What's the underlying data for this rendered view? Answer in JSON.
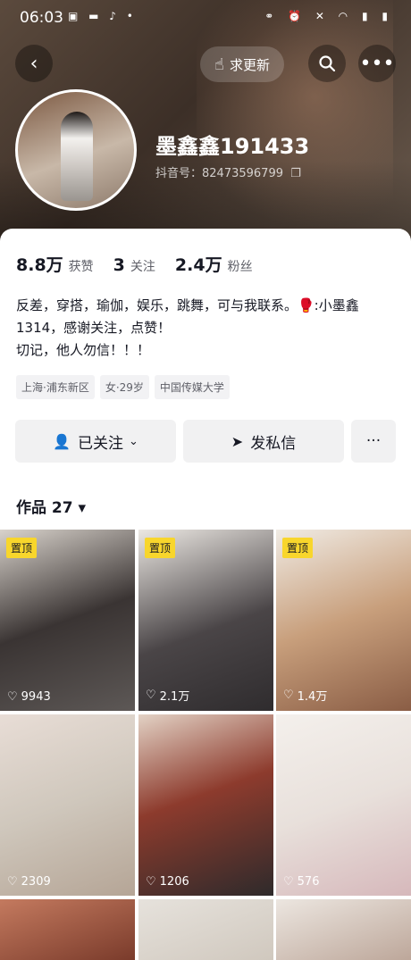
{
  "status": {
    "time": "06:03"
  },
  "header": {
    "update_label": "求更新",
    "nickname": "墨鑫鑫191433",
    "douyin_id": "抖音号：82473596799"
  },
  "stats": {
    "likes_value": "8.8万",
    "likes_label": "获赞",
    "following_value": "3",
    "following_label": "关注",
    "fans_value": "2.4万",
    "fans_label": "粉丝"
  },
  "bio": {
    "line1": "反差，穿搭，瑜伽，娱乐，跳舞，可与我联系。🥊:小墨鑫1314，感谢关注，点赞！",
    "line2": "切记，他人勿信！！！"
  },
  "tags": [
    "上海·浦东新区",
    "女·29岁",
    "中国传媒大学"
  ],
  "actions": {
    "followed": "已关注",
    "message": "发私信",
    "more": "···"
  },
  "works": {
    "label": "作品 27 ▾"
  },
  "grid": [
    {
      "pinned": "置顶",
      "likes": "9943"
    },
    {
      "pinned": "置顶",
      "likes": "2.1万"
    },
    {
      "pinned": "置顶",
      "likes": "1.4万"
    },
    {
      "pinned": "",
      "likes": "2309"
    },
    {
      "pinned": "",
      "likes": "1206"
    },
    {
      "pinned": "",
      "likes": "576"
    },
    {
      "pinned": "",
      "likes": ""
    },
    {
      "pinned": "",
      "likes": ""
    },
    {
      "pinned": "",
      "likes": ""
    }
  ],
  "icons": {
    "back": "back-icon",
    "search": "search-icon",
    "more": "more-icon",
    "hand": "hand-icon",
    "copy": "copy-icon",
    "heart": "heart-icon",
    "user-check": "user-check-icon",
    "send": "send-icon",
    "chevron": "chevron-down-icon"
  }
}
